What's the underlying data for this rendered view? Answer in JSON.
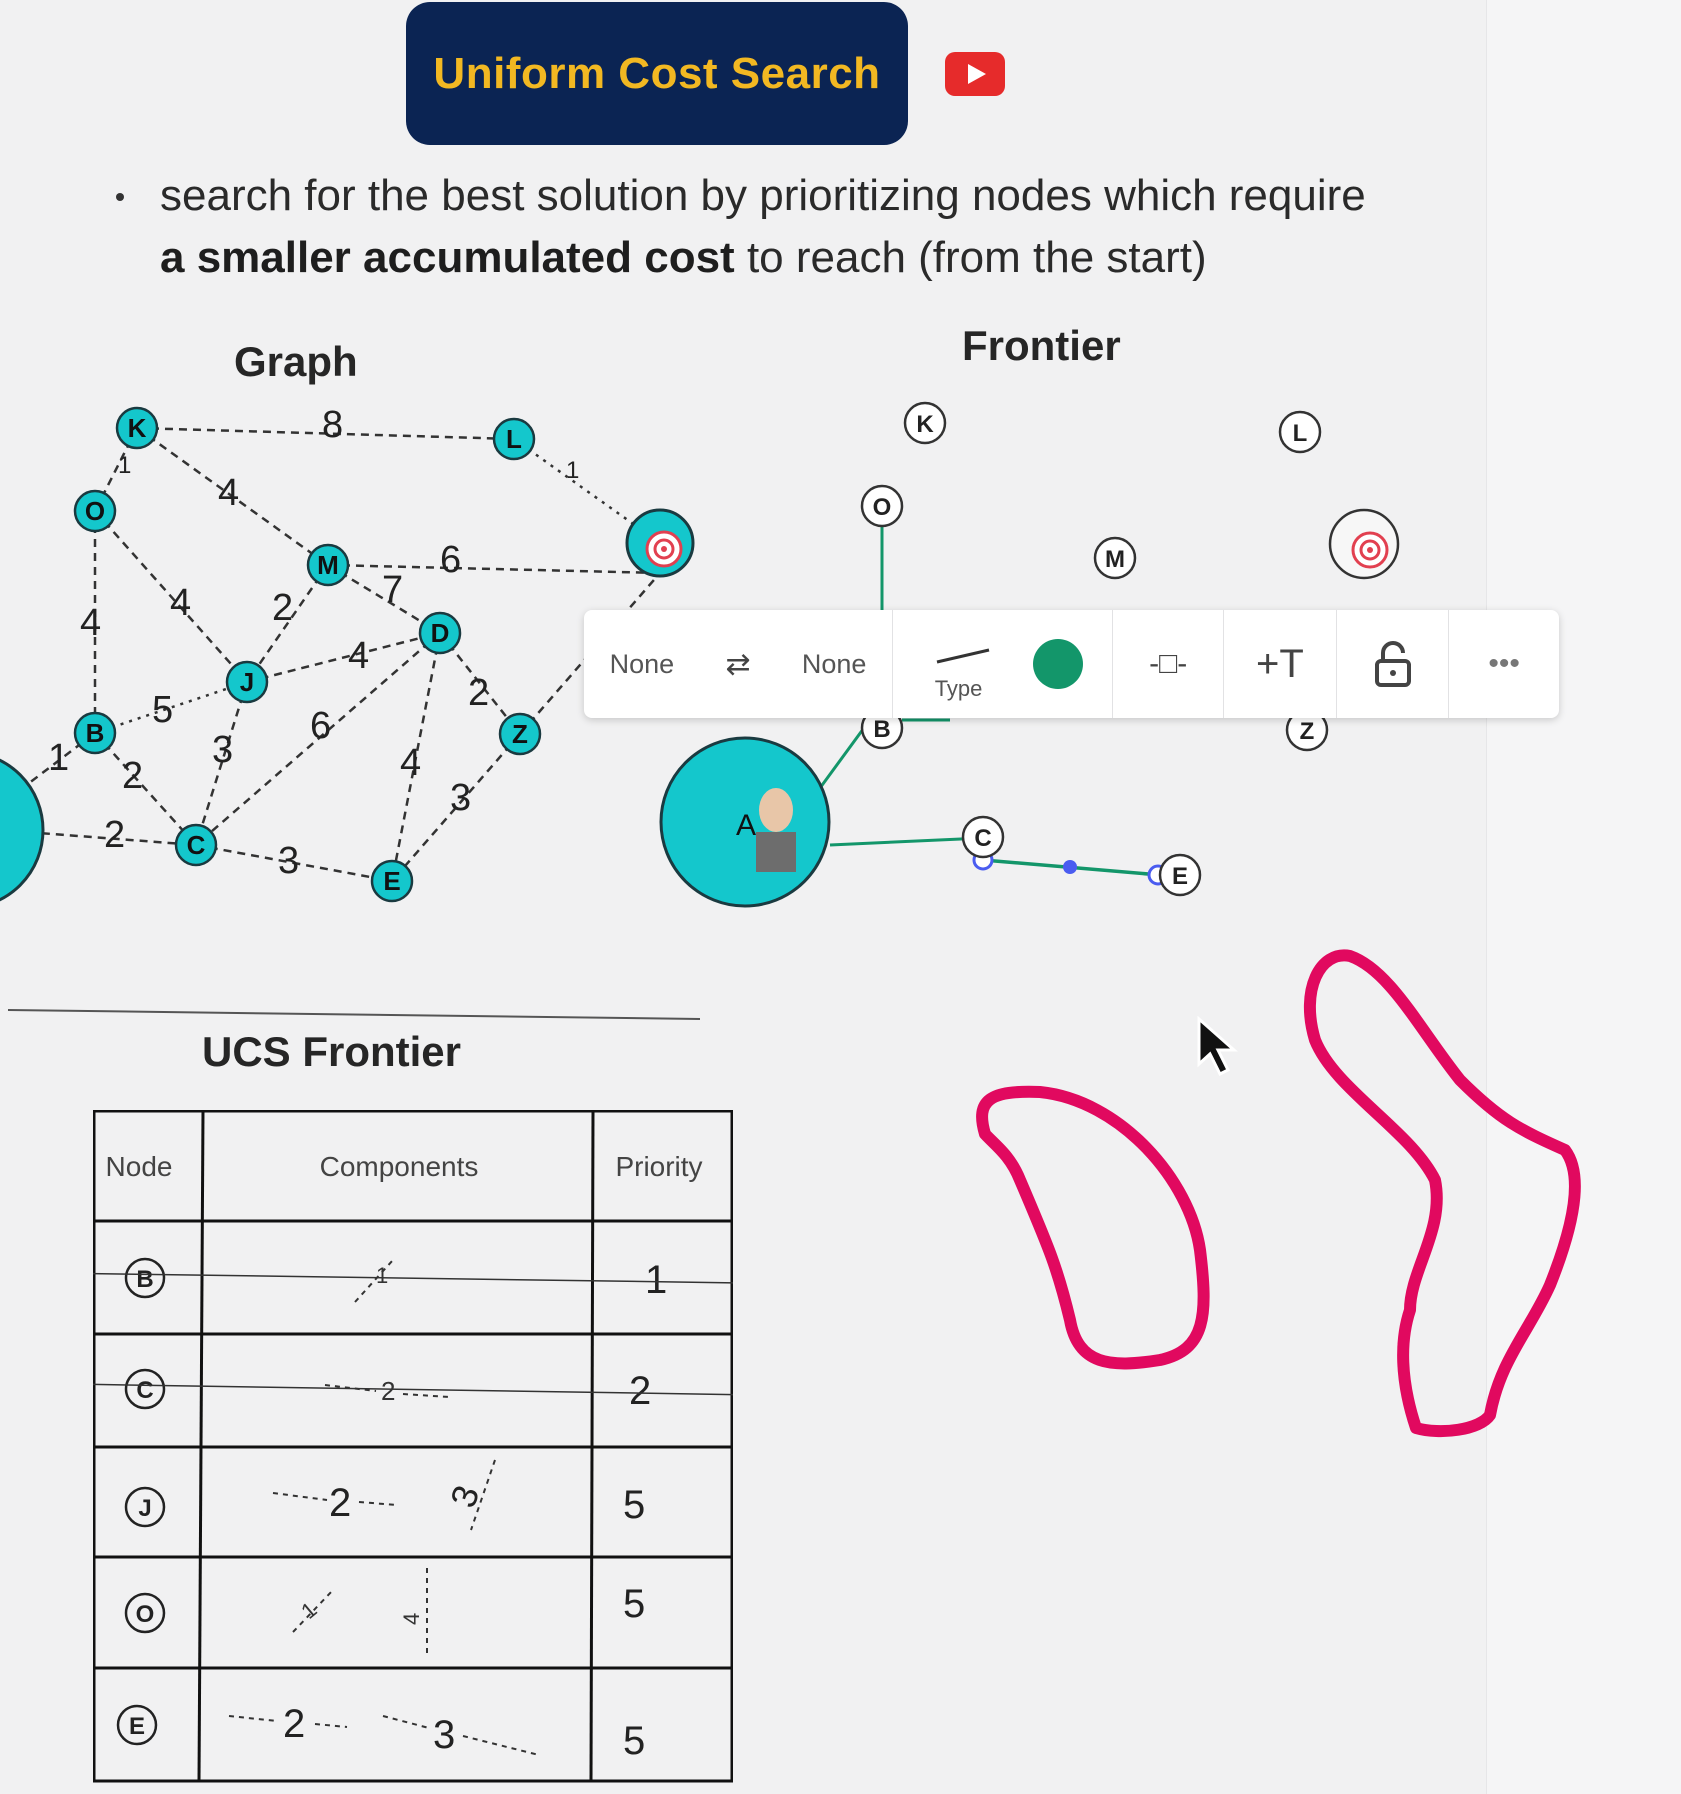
{
  "header": {
    "title": "Uniform Cost Search",
    "video_icon": "youtube-play-icon"
  },
  "bullet": {
    "prefix": "search for the best solution by prioritizing nodes which require",
    "bold": "a smaller accumulated cost",
    "suffix": " to reach (from the start)"
  },
  "graph": {
    "title": "Graph",
    "nodes": [
      "K",
      "L",
      "O",
      "M",
      "J",
      "D",
      "B",
      "Z",
      "C",
      "E"
    ],
    "edge_labels": [
      "8",
      "1",
      "1",
      "4",
      "4",
      "4",
      "6",
      "2",
      "7",
      "4",
      "5",
      "6",
      "2",
      "3",
      "2",
      "4",
      "3",
      "1",
      "2",
      "3"
    ]
  },
  "frontier": {
    "title": "Frontier",
    "nodes": [
      "K",
      "L",
      "O",
      "M",
      "B",
      "Z",
      "C",
      "E"
    ],
    "start_label": "A"
  },
  "toolbar": {
    "start_cap": "None",
    "swap_icon": "swap-arrows-icon",
    "end_cap": "None",
    "type_label": "Type",
    "color": "#13966a",
    "plus_text": "+T",
    "lock_icon": "unlock-icon",
    "more_icon": "more-dots-icon"
  },
  "ucs_frontier": {
    "title": "UCS Frontier",
    "columns": [
      "Node",
      "Components",
      "Priority"
    ],
    "rows": [
      {
        "node": "B",
        "components": "1",
        "priority": "1",
        "struck": true
      },
      {
        "node": "C",
        "components": "2",
        "priority": "2",
        "struck": true
      },
      {
        "node": "J",
        "components": [
          "2",
          "3"
        ],
        "priority": "5",
        "struck": false
      },
      {
        "node": "O",
        "components": [
          "1",
          "4"
        ],
        "priority": "5",
        "struck": false
      },
      {
        "node": "E",
        "components": [
          "2",
          "3"
        ],
        "priority": "5",
        "struck": false
      }
    ]
  },
  "colors": {
    "node_teal": "#14c7cc",
    "edge_green": "#13966a",
    "ink_pink": "#e1095f",
    "title_bg": "#0b2453",
    "title_fg": "#f2b822"
  }
}
